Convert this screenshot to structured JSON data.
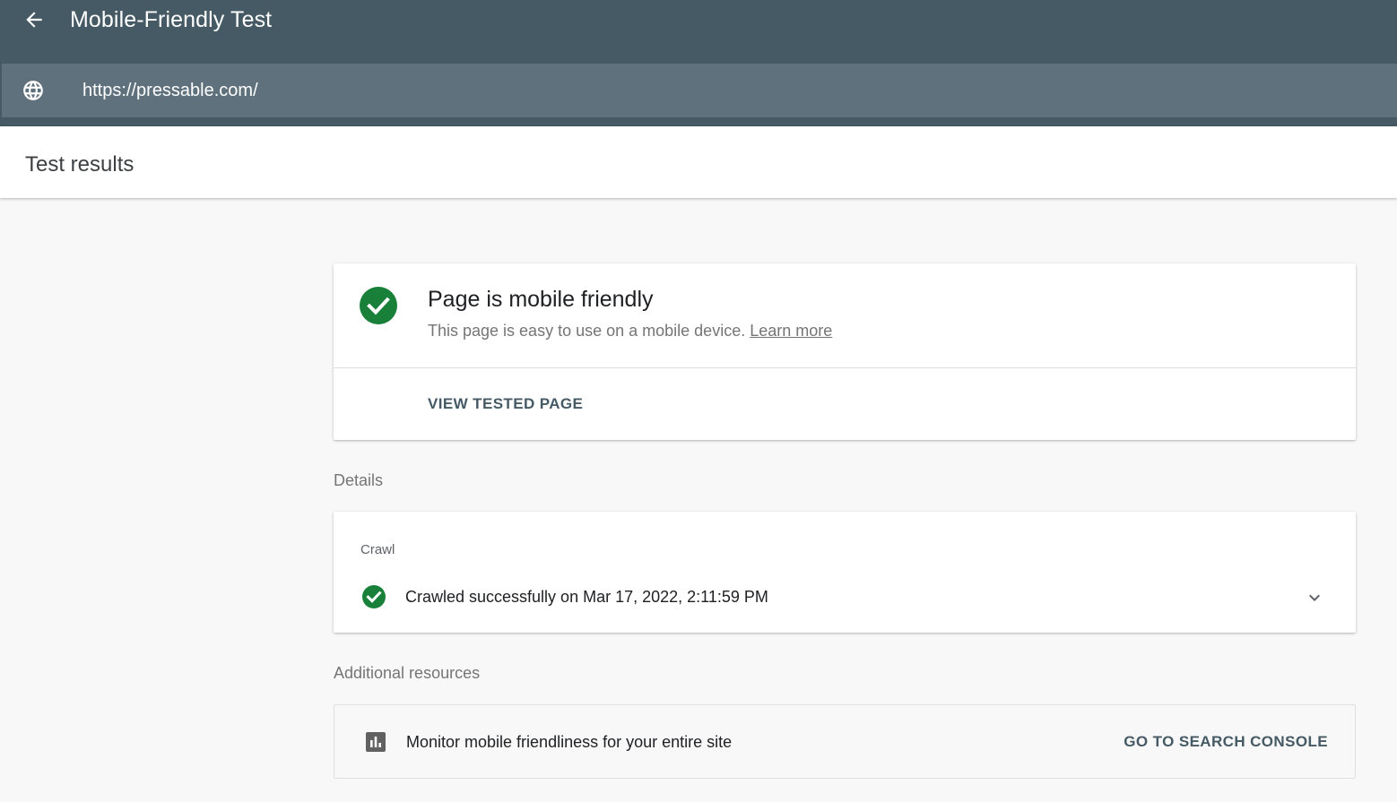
{
  "header": {
    "title": "Mobile-Friendly Test",
    "back_icon": "arrow-back-icon",
    "url_icon": "globe-icon",
    "url_value": "https://pressable.com/",
    "bg_color": "#455a64",
    "url_bar_color": "#5f717c"
  },
  "subheader": {
    "title": "Test results"
  },
  "result": {
    "status_icon": "check-circle-icon",
    "status_color": "#188038",
    "title": "Page is mobile friendly",
    "description": "This page is easy to use on a mobile device.",
    "learn_more": "Learn more",
    "action": "VIEW TESTED PAGE"
  },
  "details": {
    "label": "Details",
    "crawl": {
      "heading": "Crawl",
      "status_icon": "check-circle-icon",
      "status": "Crawled successfully on Mar 17, 2022, 2:11:59 PM",
      "expand_icon": "chevron-down-icon"
    }
  },
  "resources": {
    "label": "Additional resources",
    "item": {
      "icon": "bar-chart-icon",
      "text": "Monitor mobile friendliness for your entire site",
      "action": "GO TO SEARCH CONSOLE"
    }
  }
}
